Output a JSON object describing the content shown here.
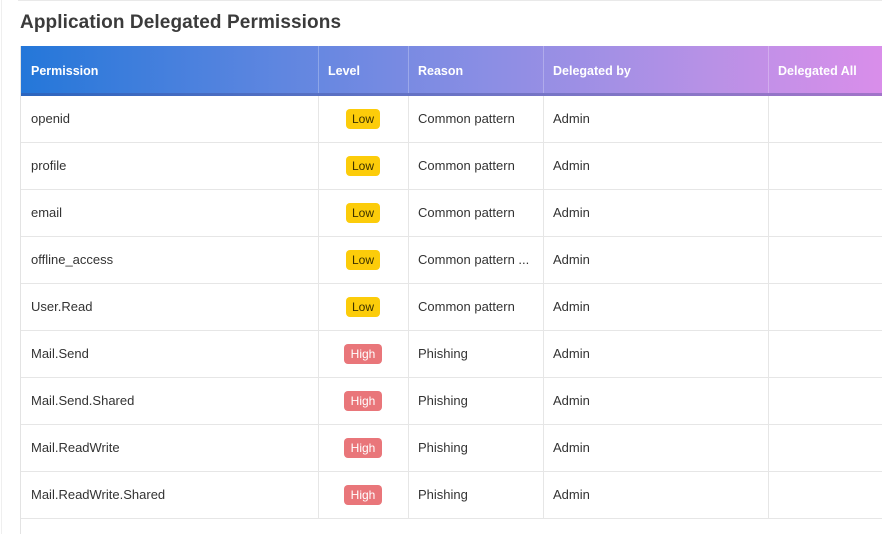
{
  "page": {
    "title": "Application Delegated Permissions"
  },
  "table": {
    "headers": {
      "permission": "Permission",
      "level": "Level",
      "reason": "Reason",
      "delegated_by": "Delegated by",
      "delegated_all": "Delegated All"
    },
    "rows": [
      {
        "permission": "openid",
        "level": "Low",
        "reason": "Common pattern",
        "delegated_by": "Admin",
        "delegated_all": ""
      },
      {
        "permission": "profile",
        "level": "Low",
        "reason": "Common pattern",
        "delegated_by": "Admin",
        "delegated_all": ""
      },
      {
        "permission": "email",
        "level": "Low",
        "reason": "Common pattern",
        "delegated_by": "Admin",
        "delegated_all": ""
      },
      {
        "permission": "offline_access",
        "level": "Low",
        "reason": "Common pattern ...",
        "delegated_by": "Admin",
        "delegated_all": ""
      },
      {
        "permission": "User.Read",
        "level": "Low",
        "reason": "Common pattern",
        "delegated_by": "Admin",
        "delegated_all": ""
      },
      {
        "permission": "Mail.Send",
        "level": "High",
        "reason": "Phishing",
        "delegated_by": "Admin",
        "delegated_all": ""
      },
      {
        "permission": "Mail.Send.Shared",
        "level": "High",
        "reason": "Phishing",
        "delegated_by": "Admin",
        "delegated_all": ""
      },
      {
        "permission": "Mail.ReadWrite",
        "level": "High",
        "reason": "Phishing",
        "delegated_by": "Admin",
        "delegated_all": ""
      },
      {
        "permission": "Mail.ReadWrite.Shared",
        "level": "High",
        "reason": "Phishing",
        "delegated_by": "Admin",
        "delegated_all": ""
      }
    ]
  },
  "colors": {
    "low_badge": "#fccc0a",
    "high_badge": "#e9767a",
    "header_gradient_start": "#2477d9",
    "header_gradient_end": "#d98eea"
  }
}
